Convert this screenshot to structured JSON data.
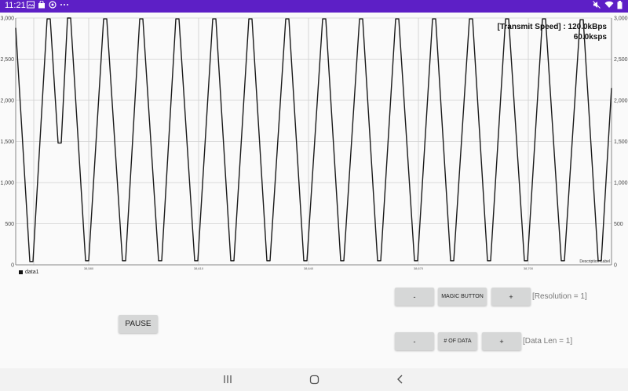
{
  "status_bar": {
    "time": "11:21",
    "icons_left": [
      "image-icon",
      "shopping-bag-icon",
      "at-sign-icon",
      "more-dots-icon"
    ],
    "icons_right": [
      "mute-icon",
      "wifi-icon",
      "battery-icon"
    ]
  },
  "chart": {
    "transmit_speed_label": "[Transmit Speed] : 120.0kBps",
    "sample_rate_label": "60.0ksps",
    "description_label": "Description Label",
    "legend_label": "data1",
    "line_color": "#1a1a1a",
    "grid_color": "#cfcfcf"
  },
  "chart_data": {
    "type": "line",
    "series": [
      {
        "name": "data1",
        "x": [],
        "y": []
      }
    ],
    "ylim": [
      0,
      3000
    ],
    "y_ticks_left": [
      "0",
      "500",
      "1,000",
      "1,500",
      "2,000",
      "2,500",
      "3,000"
    ],
    "y_ticks_right": [
      "0",
      "500",
      "1,000",
      "1,500",
      "2,000",
      "2,500",
      "3,000"
    ],
    "x_ticks": [
      "38,580",
      "38,610",
      "38,640",
      "38,670",
      "38,700"
    ],
    "grid": true,
    "legend": "bottom-left",
    "waveform": {
      "peaks": [
        2990,
        3000,
        2990,
        2990,
        2990,
        2990,
        2990,
        2990,
        2990,
        2990,
        2990,
        2990,
        2990,
        2990,
        2990,
        2980
      ],
      "troughs": [
        40,
        1480,
        50,
        50,
        50,
        50,
        50,
        50,
        50,
        50,
        50,
        50,
        50,
        50,
        50,
        50
      ],
      "start_value": 2880,
      "end_value": 2150
    }
  },
  "controls": {
    "pause": "PAUSE",
    "res_minus": "-",
    "magic": "MAGIC BUTTON",
    "res_plus": "+",
    "resolution_label": "[Resolution = 1]",
    "len_minus": "-",
    "num_data": "# OF DATA",
    "len_plus": "+",
    "data_len_label": "[Data Len = 1]"
  },
  "nav": {
    "recents": "|||",
    "home": "○",
    "back": "‹"
  }
}
